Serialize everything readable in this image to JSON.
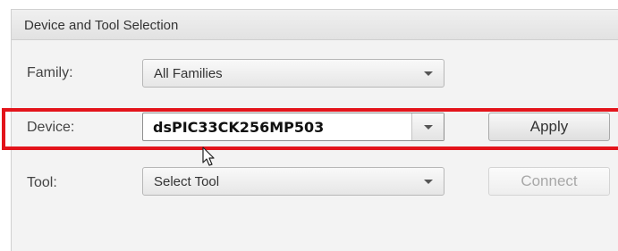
{
  "panel": {
    "title": "Device and Tool Selection"
  },
  "family": {
    "label": "Family:",
    "selected": "All Families"
  },
  "device": {
    "label": "Device:",
    "value": "dsPIC33CK256MP503"
  },
  "tool": {
    "label": "Tool:",
    "selected": "Select Tool"
  },
  "buttons": {
    "apply": "Apply",
    "connect": "Connect"
  },
  "icons": {
    "dropdown": "chevron-down-icon",
    "cursor": "mouse-pointer-icon"
  },
  "colors": {
    "highlight": "#e3141b",
    "panel_bg": "#f3f3f3",
    "disabled_text": "#a8a8a8"
  }
}
